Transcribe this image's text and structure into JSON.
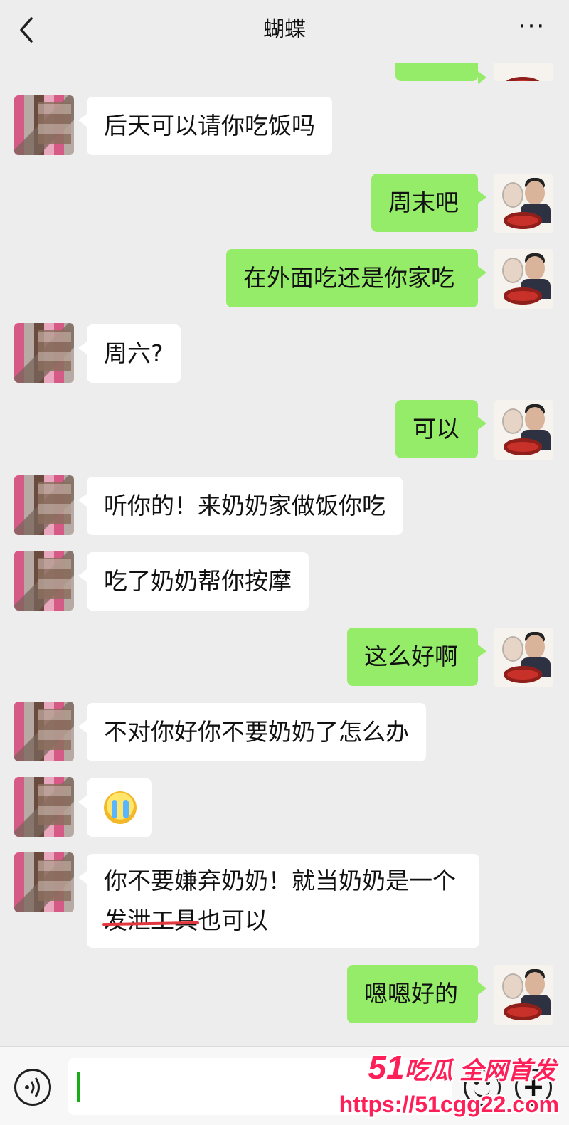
{
  "header": {
    "title": "蝴蝶",
    "back_icon": "chevron-left-icon",
    "more_label": "···"
  },
  "messages": [
    {
      "side": "right",
      "text": ""
    },
    {
      "side": "left",
      "text": "后天可以请你吃饭吗"
    },
    {
      "side": "right",
      "text": "周末吧"
    },
    {
      "side": "right",
      "text": "在外面吃还是你家吃"
    },
    {
      "side": "left",
      "text": "周六?"
    },
    {
      "side": "right",
      "text": "可以"
    },
    {
      "side": "left",
      "text": "听你的！来奶奶家做饭你吃"
    },
    {
      "side": "left",
      "text": "吃了奶奶帮你按摩"
    },
    {
      "side": "right",
      "text": "这么好啊"
    },
    {
      "side": "left",
      "text": "不对你好你不要奶奶了怎么办"
    },
    {
      "side": "left",
      "emoji": "crying-face-emoji"
    },
    {
      "side": "left",
      "text_line1": "你不要嫌弃奶奶！就当奶奶是一个",
      "text_struck": "发泄工具",
      "text_rest": "也可以"
    },
    {
      "side": "right",
      "text": "嗯嗯好的"
    }
  ],
  "input_bar": {
    "voice_icon": "voice-icon",
    "emoji_icon": "emoji-icon",
    "plus_icon": "plus-icon",
    "value": ""
  },
  "watermark": {
    "line1_num": "51",
    "line1_text": "吃瓜 全网首发",
    "line2": "https://51cgg22.com"
  },
  "colors": {
    "background": "#ededed",
    "bubble_me": "#95ec69",
    "bubble_other": "#ffffff",
    "strike": "#e0383e",
    "watermark": "#ff1f58"
  }
}
